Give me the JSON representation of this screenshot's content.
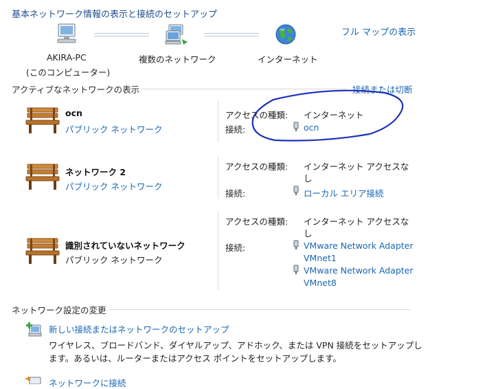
{
  "header": {
    "title": "基本ネットワーク情報の表示と接続のセットアップ",
    "full_map_link": "フル マップの表示"
  },
  "map": {
    "computer_name": "AKIRA-PC",
    "computer_sub": "(このコンピューター)",
    "multi_network": "複数のネットワーク",
    "internet": "インターネット"
  },
  "active": {
    "title": "アクティブなネットワークの表示",
    "connect_link": "接続または切断",
    "access_label": "アクセスの種類:",
    "conn_label": "接続:",
    "networks": [
      {
        "name": "ocn",
        "type": "パブリック ネットワーク",
        "access": "インターネット",
        "connections": [
          "ocn"
        ]
      },
      {
        "name": "ネットワーク 2",
        "type": "パブリック ネットワーク",
        "access_line1": "インターネット アクセスな",
        "access_line2": "し",
        "connections": [
          "ローカル エリア接続"
        ]
      },
      {
        "name": "識別されていないネットワーク",
        "type": "パブリック ネットワーク",
        "access_line1": "インターネット アクセスな",
        "access_line2": "し",
        "connections": [
          {
            "line1": "VMware Network Adapter",
            "line2": "VMnet1"
          },
          {
            "line1": "VMware Network Adapter",
            "line2": "VMnet8"
          }
        ]
      }
    ]
  },
  "settings": {
    "title": "ネットワーク設定の変更",
    "items": [
      {
        "link": "新しい接続またはネットワークのセットアップ",
        "desc_line1": "ワイヤレス、ブロードバンド、ダイヤルアップ、アドホック、または VPN 接続をセットアップし",
        "desc_line2": "ます。あるいは、ルーターまたはアクセス ポイントをセットアップします。"
      },
      {
        "link": "ネットワークに接続"
      }
    ]
  },
  "annotation": {
    "color": "#1a2fb8"
  }
}
